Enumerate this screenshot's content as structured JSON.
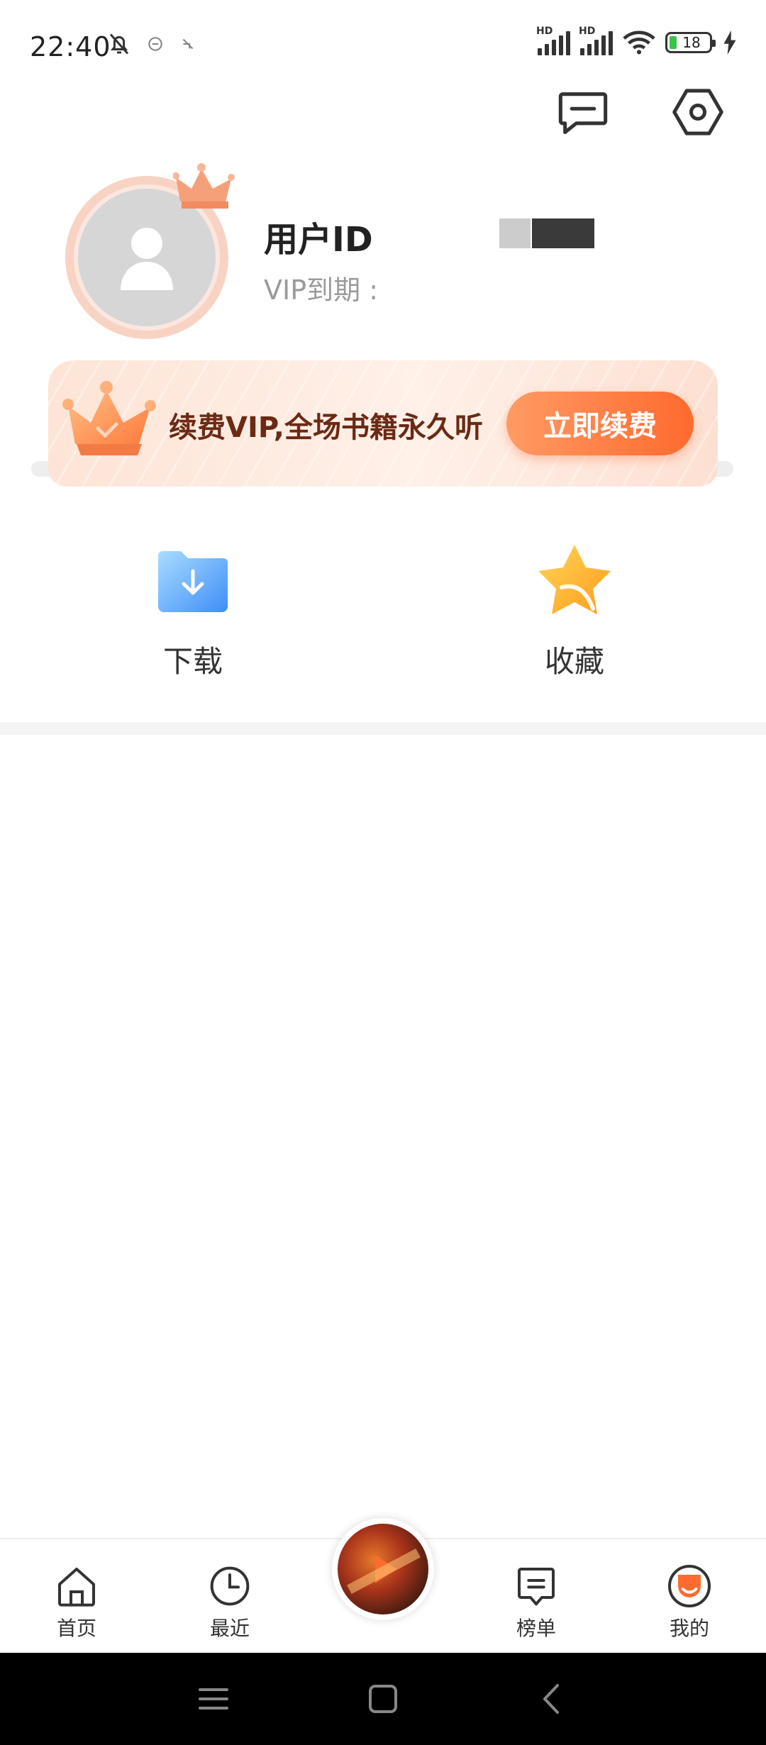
{
  "status_bar": {
    "time": "22:40",
    "battery_level": "18",
    "icons": [
      "bell-off-icon",
      "app-notify-icon",
      "app-notify-icon-2",
      "signal-icon",
      "signal-icon-2",
      "wifi-icon",
      "battery-icon",
      "charging-icon"
    ]
  },
  "header": {
    "message_icon": "message-icon",
    "settings_icon": "settings-hexagon-icon"
  },
  "profile": {
    "user_id_label": "用户ID",
    "vip_expire_label": "VIP到期 :"
  },
  "vip_banner": {
    "text": "续费VIP,全场书籍永久听",
    "button_label": "立即续费"
  },
  "shortcuts": [
    {
      "label": "下载",
      "icon": "download-folder-icon"
    },
    {
      "label": "收藏",
      "icon": "star-icon"
    }
  ],
  "bottom_nav": {
    "items": [
      {
        "label": "首页",
        "icon": "home-icon"
      },
      {
        "label": "最近",
        "icon": "clock-icon"
      },
      {
        "label": "榜单",
        "icon": "ranking-icon"
      },
      {
        "label": "我的",
        "icon": "profile-tab-icon",
        "active": true
      }
    ],
    "center": "now-playing-disc"
  },
  "system_nav": [
    "menu-icon",
    "home-square-icon",
    "back-icon"
  ],
  "colors": {
    "accent": "#ff6a2e",
    "vip_text": "#6b2a14",
    "banner_bg": "#fde4d6"
  }
}
